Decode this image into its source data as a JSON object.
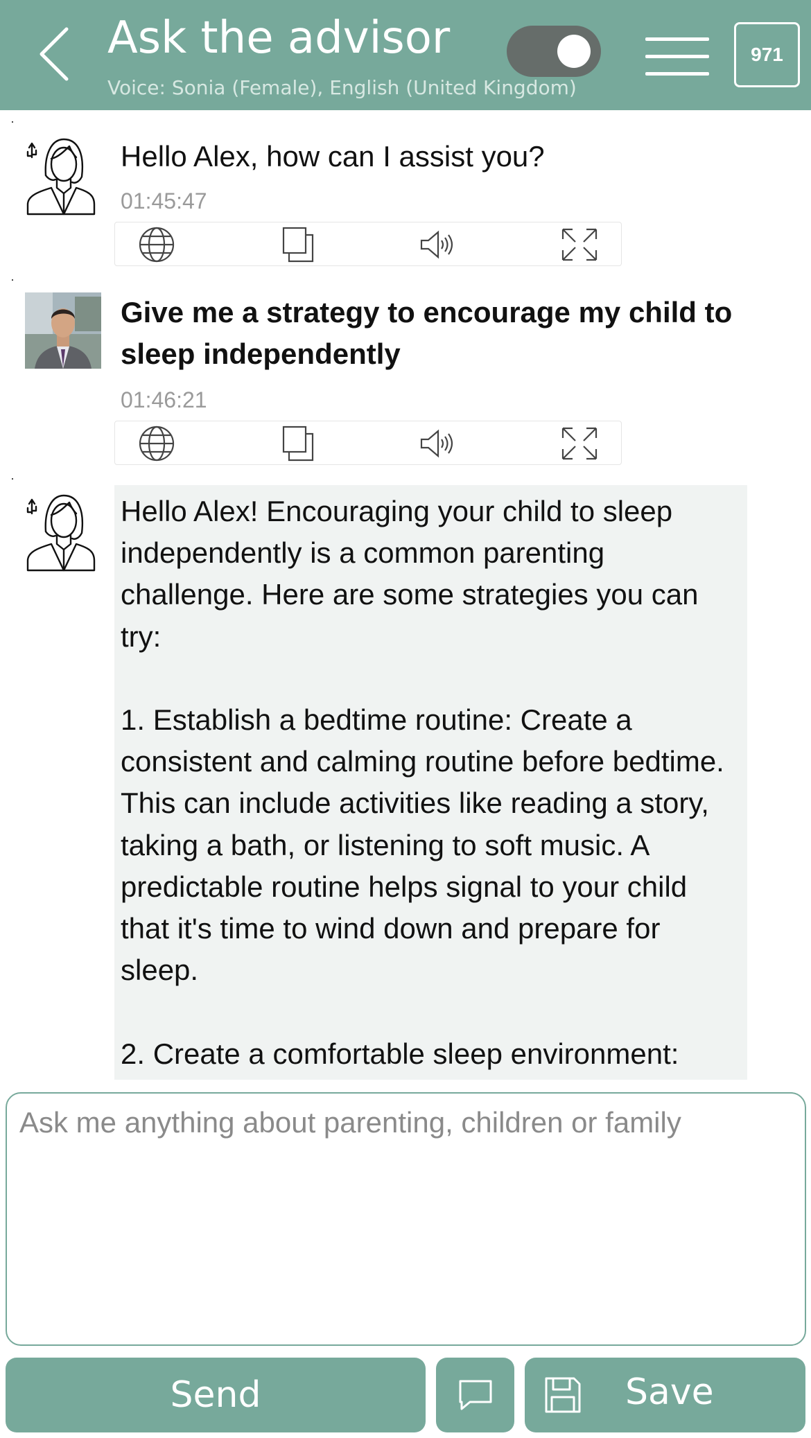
{
  "header": {
    "title": "Ask the advisor",
    "subtitle": "Voice: Sonia (Female), English (United Kingdom)",
    "counter": "971",
    "toggle_on": true,
    "color": "#77a99b"
  },
  "messages": [
    {
      "sender": "advisor",
      "avatar_icon": "advisor-avatar-icon",
      "text": "Hello Alex, how can I assist you?",
      "time": "01:45:47"
    },
    {
      "sender": "user",
      "avatar_icon": "user-photo",
      "text": "Give me a strategy to encourage my child to sleep independently",
      "time": "01:46:21"
    },
    {
      "sender": "advisor",
      "avatar_icon": "advisor-avatar-icon",
      "text": "Hello Alex! Encouraging your child to sleep independently is a common parenting challenge. Here are some strategies you can try:\n\n1. Establish a bedtime routine: Create a consistent and calming routine before bedtime. This can include activities like reading a story, taking a bath, or listening to soft music. A predictable routine helps signal to your child that it's time to wind down and prepare for sleep.\n\n2. Create a comfortable sleep environment:"
    }
  ],
  "toolbar_icons": [
    "globe-icon",
    "copy-icon",
    "speaker-icon",
    "expand-icon"
  ],
  "input": {
    "placeholder": "Ask me anything about parenting, children or family",
    "value": ""
  },
  "buttons": {
    "send_label": "Send",
    "save_label": "Save",
    "chat_icon": "chat-bubble-icon",
    "save_icon": "floppy-disk-icon"
  }
}
